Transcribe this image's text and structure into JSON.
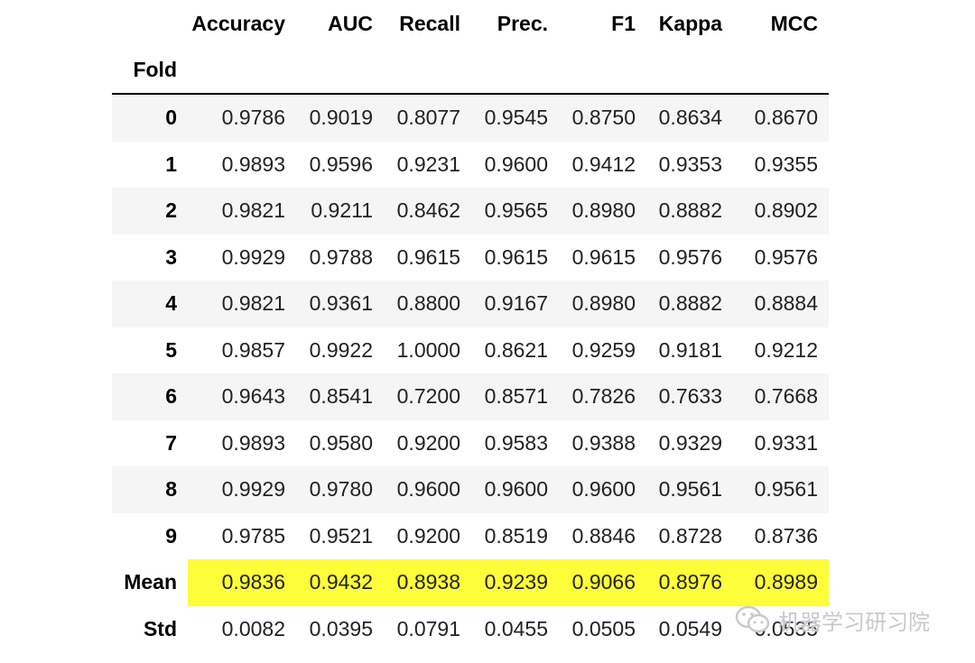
{
  "table": {
    "columns": [
      "Accuracy",
      "AUC",
      "Recall",
      "Prec.",
      "F1",
      "Kappa",
      "MCC"
    ],
    "index_name": "Fold",
    "rows": [
      {
        "index": "0",
        "values": [
          "0.9786",
          "0.9019",
          "0.8077",
          "0.9545",
          "0.8750",
          "0.8634",
          "0.8670"
        ]
      },
      {
        "index": "1",
        "values": [
          "0.9893",
          "0.9596",
          "0.9231",
          "0.9600",
          "0.9412",
          "0.9353",
          "0.9355"
        ]
      },
      {
        "index": "2",
        "values": [
          "0.9821",
          "0.9211",
          "0.8462",
          "0.9565",
          "0.8980",
          "0.8882",
          "0.8902"
        ]
      },
      {
        "index": "3",
        "values": [
          "0.9929",
          "0.9788",
          "0.9615",
          "0.9615",
          "0.9615",
          "0.9576",
          "0.9576"
        ]
      },
      {
        "index": "4",
        "values": [
          "0.9821",
          "0.9361",
          "0.8800",
          "0.9167",
          "0.8980",
          "0.8882",
          "0.8884"
        ]
      },
      {
        "index": "5",
        "values": [
          "0.9857",
          "0.9922",
          "1.0000",
          "0.8621",
          "0.9259",
          "0.9181",
          "0.9212"
        ]
      },
      {
        "index": "6",
        "values": [
          "0.9643",
          "0.8541",
          "0.7200",
          "0.8571",
          "0.7826",
          "0.7633",
          "0.7668"
        ]
      },
      {
        "index": "7",
        "values": [
          "0.9893",
          "0.9580",
          "0.9200",
          "0.9583",
          "0.9388",
          "0.9329",
          "0.9331"
        ]
      },
      {
        "index": "8",
        "values": [
          "0.9929",
          "0.9780",
          "0.9600",
          "0.9600",
          "0.9600",
          "0.9561",
          "0.9561"
        ]
      },
      {
        "index": "9",
        "values": [
          "0.9785",
          "0.9521",
          "0.9200",
          "0.8519",
          "0.8846",
          "0.8728",
          "0.8736"
        ]
      },
      {
        "index": "Mean",
        "values": [
          "0.9836",
          "0.9432",
          "0.8938",
          "0.9239",
          "0.9066",
          "0.8976",
          "0.8989"
        ],
        "highlight": true
      },
      {
        "index": "Std",
        "values": [
          "0.0082",
          "0.0395",
          "0.0791",
          "0.0455",
          "0.0505",
          "0.0549",
          "0.0535"
        ]
      }
    ],
    "highlight_color": "#fdfd3a",
    "stripe_color": "#f5f5f5"
  },
  "watermark": {
    "text": "机器学习研习院",
    "icon": "wechat-icon"
  }
}
